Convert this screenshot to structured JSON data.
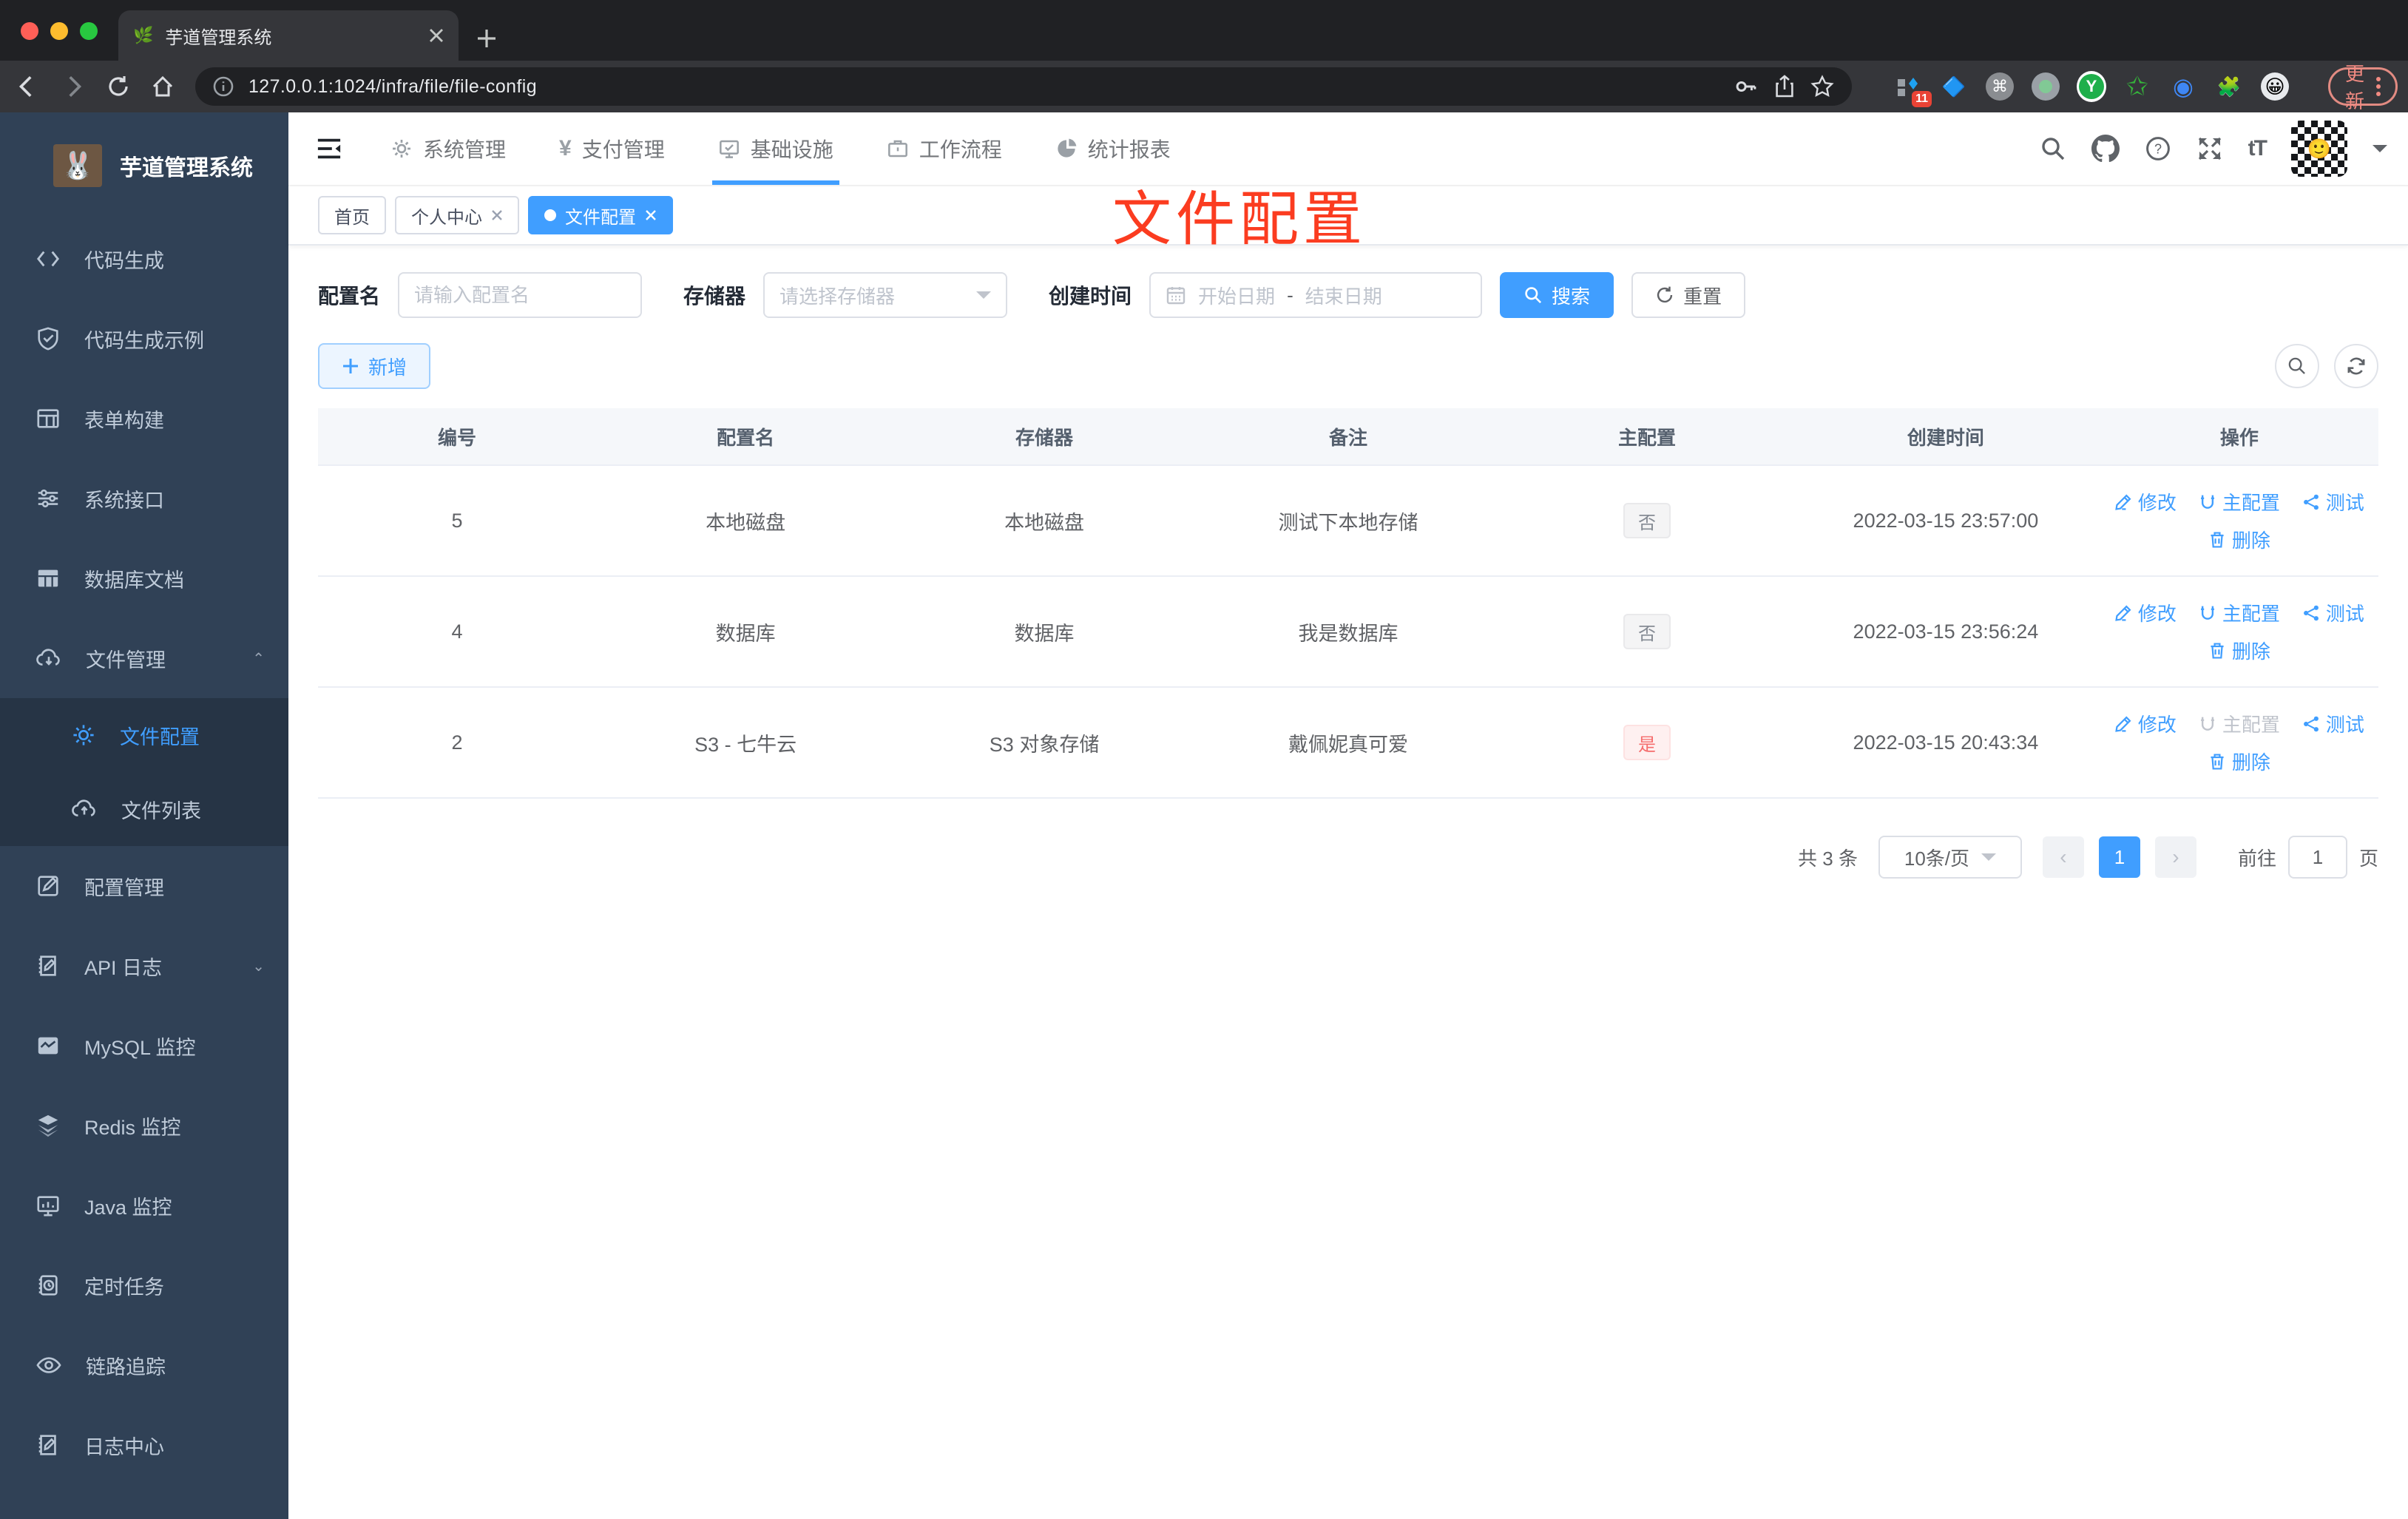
{
  "browser": {
    "tab_title": "芋道管理系统",
    "url": "127.0.0.1:1024/infra/file/file-config",
    "update_label": "更新",
    "extensions_badge": "11"
  },
  "icons": {
    "plant": "🌿",
    "rabbit": "🐰",
    "command": "⌘",
    "gem": "🔷",
    "green_star": "✩",
    "blue_eye": "◉",
    "puzzle": "🧩",
    "emoji": "😀",
    "avatar_emoji": "🙂",
    "y_logo": "Y",
    "yen": "¥",
    "font_size": "tT"
  },
  "sidebar": {
    "title": "芋道管理系统",
    "items": [
      {
        "label": "代码生成"
      },
      {
        "label": "代码生成示例"
      },
      {
        "label": "表单构建"
      },
      {
        "label": "系统接口"
      },
      {
        "label": "数据库文档"
      },
      {
        "label": "文件管理"
      },
      {
        "label": "文件配置"
      },
      {
        "label": "文件列表"
      },
      {
        "label": "配置管理"
      },
      {
        "label": "API 日志"
      },
      {
        "label": "MySQL 监控"
      },
      {
        "label": "Redis 监控"
      },
      {
        "label": "Java 监控"
      },
      {
        "label": "定时任务"
      },
      {
        "label": "链路追踪"
      },
      {
        "label": "日志中心"
      }
    ]
  },
  "topnav": {
    "items": [
      {
        "label": "系统管理"
      },
      {
        "label": "支付管理"
      },
      {
        "label": "基础设施"
      },
      {
        "label": "工作流程"
      },
      {
        "label": "统计报表"
      }
    ]
  },
  "tags": {
    "home": "首页",
    "profile": "个人中心",
    "current": "文件配置"
  },
  "annotation": {
    "text": "文件配置",
    "color": "#fb3c20"
  },
  "filters": {
    "name_label": "配置名",
    "name_placeholder": "请输入配置名",
    "storage_label": "存储器",
    "storage_placeholder": "请选择存储器",
    "date_label": "创建时间",
    "date_start_placeholder": "开始日期",
    "date_separator": "-",
    "date_end_placeholder": "结束日期",
    "search_label": "搜索",
    "reset_label": "重置"
  },
  "toolbar": {
    "add_label": "新增"
  },
  "table": {
    "headers": [
      "编号",
      "配置名",
      "存储器",
      "备注",
      "主配置",
      "创建时间",
      "操作"
    ],
    "actions": {
      "edit": "修改",
      "master": "主配置",
      "test": "测试",
      "delete": "删除"
    },
    "rows": [
      {
        "id": "5",
        "name": "本地磁盘",
        "storage": "本地磁盘",
        "remark": "测试下本地存储",
        "master": "否",
        "created": "2022-03-15 23:57:00"
      },
      {
        "id": "4",
        "name": "数据库",
        "storage": "数据库",
        "remark": "我是数据库",
        "master": "否",
        "created": "2022-03-15 23:56:24"
      },
      {
        "id": "2",
        "name": "S3 - 七牛云",
        "storage": "S3 对象存储",
        "remark": "戴佩妮真可爱",
        "master": "是",
        "created": "2022-03-15 20:43:34"
      }
    ]
  },
  "pagination": {
    "total": "共 3 条",
    "page_size": "10条/页",
    "current_page": "1",
    "goto_label": "前往",
    "goto_value": "1",
    "page_unit": "页"
  },
  "colors": {
    "accent": "#409eff",
    "danger": "#f56c6c",
    "sidebar_bg": "#304156",
    "submenu_bg": "#263445",
    "annotation_red": "#fb3c20"
  }
}
